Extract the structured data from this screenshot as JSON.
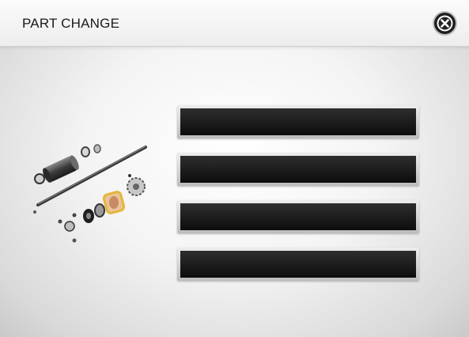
{
  "header": {
    "title": "PART CHANGE"
  },
  "close": {
    "icon": "close-icon"
  },
  "illustration": {
    "icon": "exploded-part-assembly",
    "highlight_color": "#e7b63a"
  },
  "slots": [
    "",
    "",
    "",
    ""
  ]
}
